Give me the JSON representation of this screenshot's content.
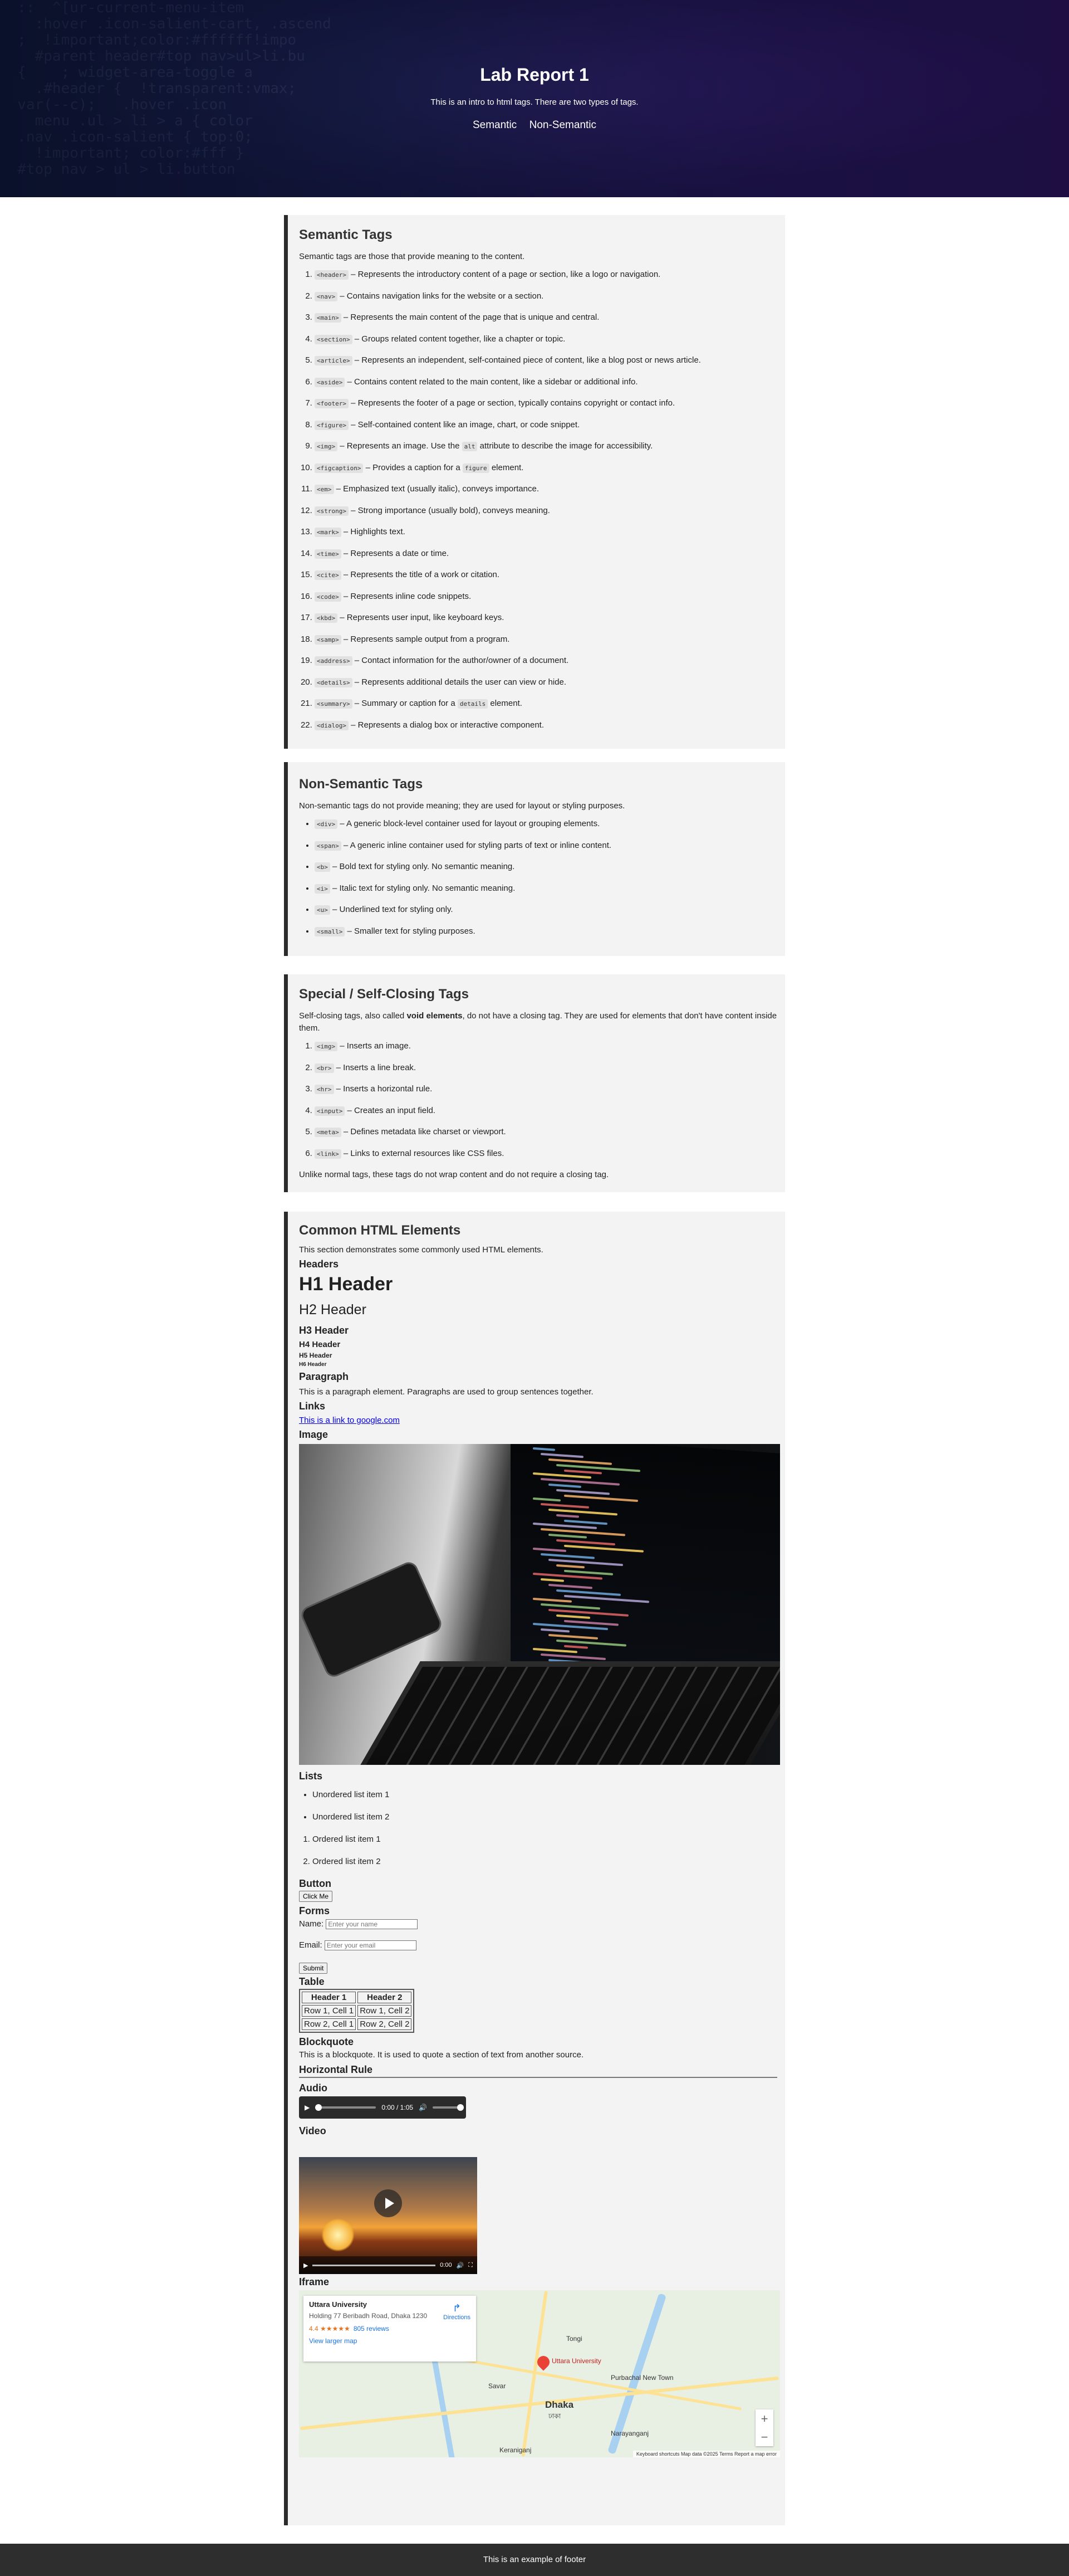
{
  "header": {
    "title": "Lab Report 1",
    "intro": "This is an intro to html tags. There are two types of tags.",
    "nav": [
      "Semantic",
      "Non-Semantic"
    ],
    "bg_code": [
      "  ::  ^[ur-current-menu-item",
      "    :hover .icon-salient-cart, .ascend",
      "  ;  !important;color:#ffffff!impo",
      "    #parent header#top nav>ul>li.bu",
      "  {    ; widget-area-toggle a",
      "    .#header {  !transparent:vmax;",
      "  var(--c);   .hover .icon",
      "    menu .ul > li > a { color",
      "  .nav .icon-salient { top:0;",
      "    !important; color:#fff }",
      "  #top nav > ul > li.button"
    ]
  },
  "semantic": {
    "title": "Semantic Tags",
    "desc": "Semantic tags are those that provide meaning to the content.",
    "items": [
      {
        "tag": "<header>",
        "text": "– Represents the introductory content of a page or section, like a logo or navigation."
      },
      {
        "tag": "<nav>",
        "text": "– Contains navigation links for the website or a section."
      },
      {
        "tag": "<main>",
        "text": "– Represents the main content of the page that is unique and central."
      },
      {
        "tag": "<section>",
        "text": "– Groups related content together, like a chapter or topic."
      },
      {
        "tag": "<article>",
        "text": "– Represents an independent, self-contained piece of content, like a blog post or news article."
      },
      {
        "tag": "<aside>",
        "text": "– Contains content related to the main content, like a sidebar or additional info."
      },
      {
        "tag": "<footer>",
        "text": "– Represents the footer of a page or section, typically contains copyright or contact info."
      },
      {
        "tag": "<figure>",
        "text": "– Self-contained content like an image, chart, or code snippet."
      },
      {
        "tag": "<img>",
        "text": "– Represents an image. Use the",
        "tag2": "alt",
        "text2": "attribute to describe the image for accessibility."
      },
      {
        "tag": "<figcaption>",
        "text": "– Provides a caption for a",
        "tag2": "figure",
        "text2": "element."
      },
      {
        "tag": "<em>",
        "text": "– Emphasized text (usually italic), conveys importance."
      },
      {
        "tag": "<strong>",
        "text": "– Strong importance (usually bold), conveys meaning."
      },
      {
        "tag": "<mark>",
        "text": "– Highlights text."
      },
      {
        "tag": "<time>",
        "text": "– Represents a date or time."
      },
      {
        "tag": "<cite>",
        "text": "– Represents the title of a work or citation."
      },
      {
        "tag": "<code>",
        "text": "– Represents inline code snippets."
      },
      {
        "tag": "<kbd>",
        "text": "– Represents user input, like keyboard keys."
      },
      {
        "tag": "<samp>",
        "text": "– Represents sample output from a program."
      },
      {
        "tag": "<address>",
        "text": "– Contact information for the author/owner of a document."
      },
      {
        "tag": "<details>",
        "text": "– Represents additional details the user can view or hide."
      },
      {
        "tag": "<summary>",
        "text": "– Summary or caption for a",
        "tag2": "details",
        "text2": "element."
      },
      {
        "tag": "<dialog>",
        "text": "– Represents a dialog box or interactive component."
      }
    ]
  },
  "nonsemantic": {
    "title": "Non-Semantic Tags",
    "desc": "Non-semantic tags do not provide meaning; they are used for layout or styling purposes.",
    "items": [
      {
        "tag": "<div>",
        "text": "– A generic block-level container used for layout or grouping elements."
      },
      {
        "tag": "<span>",
        "text": "– A generic inline container used for styling parts of text or inline content."
      },
      {
        "tag": "<b>",
        "text": "– Bold text for styling only. No semantic meaning."
      },
      {
        "tag": "<i>",
        "text": "– Italic text for styling only. No semantic meaning."
      },
      {
        "tag": "<u>",
        "text": "– Underlined text for styling only."
      },
      {
        "tag": "<small>",
        "text": "– Smaller text for styling purposes."
      }
    ]
  },
  "special": {
    "title": "Special / Self-Closing Tags",
    "desc_pre": "Self-closing tags, also called ",
    "desc_bold": "void elements",
    "desc_post": ", do not have a closing tag. They are used for elements that don't have content inside them.",
    "items": [
      {
        "tag": "<img>",
        "text": "– Inserts an image."
      },
      {
        "tag": "<br>",
        "text": "– Inserts a line break."
      },
      {
        "tag": "<hr>",
        "text": "– Inserts a horizontal rule."
      },
      {
        "tag": "<input>",
        "text": "– Creates an input field."
      },
      {
        "tag": "<meta>",
        "text": "– Defines metadata like charset or viewport."
      },
      {
        "tag": "<link>",
        "text": "– Links to external resources like CSS files."
      }
    ],
    "note": "Unlike normal tags, these tags do not wrap content and do not require a closing tag."
  },
  "common": {
    "title": "Common HTML Elements",
    "desc": "This section demonstrates some commonly used HTML elements.",
    "headers_label": "Headers",
    "h1": "H1 Header",
    "h2": "H2 Header",
    "h3": "H3 Header",
    "h4": "H4 Header",
    "h5": "H5 Header",
    "h6": "H6 Header",
    "paragraph_label": "Paragraph",
    "paragraph_text": "This is a paragraph element. Paragraphs are used to group sentences together.",
    "links_label": "Links",
    "link_text": "This is a link to google.com",
    "image_label": "Image",
    "lists_label": "Lists",
    "ul": [
      "Unordered list item 1",
      "Unordered list item 2"
    ],
    "ol": [
      "Ordered list item 1",
      "Ordered list item 2"
    ],
    "button_label": "Button",
    "button_text": "Click Me",
    "forms_label": "Forms",
    "name_label": "Name:",
    "name_placeholder": "Enter your name",
    "email_label": "Email:",
    "email_placeholder": "Enter your email",
    "submit_text": "Submit",
    "table_label": "Table",
    "table_headers": [
      "Header 1",
      "Header 2"
    ],
    "table_rows": [
      [
        "Row 1, Cell 1",
        "Row 1, Cell 2"
      ],
      [
        "Row 2, Cell 1",
        "Row 2, Cell 2"
      ]
    ],
    "blockquote_label": "Blockquote",
    "blockquote_text": "This is a blockquote. It is used to quote a section of text from another source.",
    "hr_label": "Horizontal Rule",
    "audio_label": "Audio",
    "audio_time": "0:00 / 1:05",
    "video_label": "Video",
    "video_time": "0:00",
    "iframe_label": "Iframe",
    "map": {
      "place": "Uttara University",
      "address": "Holding 77 Beribadh Road, Dhaka 1230",
      "rating": "4.4 ★★★★★",
      "reviews": "805 reviews",
      "larger": "View larger map",
      "directions": "Directions",
      "city": "Dhaka",
      "city_bn": "ঢাকা",
      "pin_label": "Uttara University",
      "places": [
        "Savar",
        "Tongi",
        "Narayanganj",
        "Keraniganj",
        "Purbachal New Town"
      ],
      "attribution": "Keyboard shortcuts   Map data ©2025   Terms   Report a map error"
    }
  },
  "footer": {
    "text": "This is an example of footer"
  },
  "colors": {
    "accent_border": "#2b2b2b",
    "card_bg": "#f3f3f3",
    "footer_bg": "#2e2e2e"
  }
}
